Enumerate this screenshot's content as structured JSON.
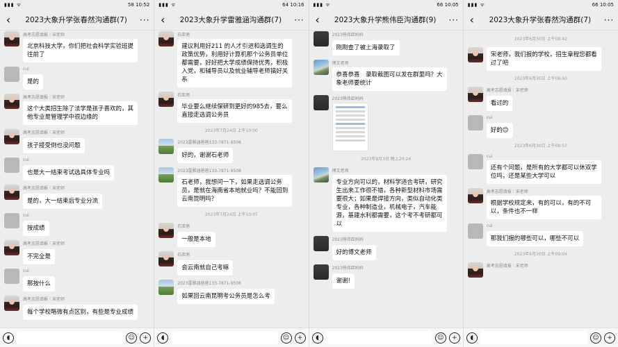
{
  "panels": [
    {
      "status": {
        "time": "10:52",
        "battery": "58"
      },
      "title": "2023大象升学张春然沟通群(7)",
      "messages": [
        {
          "type": "msg",
          "avatar": "person",
          "name": "高考志愿填报｜宋老师",
          "text": "北京科技大学，你们把社会科学实验班提往前了"
        },
        {
          "type": "msg",
          "avatar": "gray",
          "name": "cui",
          "text": "是的"
        },
        {
          "type": "msg",
          "avatar": "person",
          "name": "高考志愿填报｜宋老师",
          "text": "这个大类招生除了法学是孩子喜欢的，其他专业是管理学中很边缘的"
        },
        {
          "type": "msg",
          "avatar": "person",
          "name": "高考志愿填报｜宋老师",
          "text": "孩子接受倒也没问题"
        },
        {
          "type": "msg",
          "avatar": "gray",
          "name": "cui",
          "text": "也是大一结束考试选具体专业吗"
        },
        {
          "type": "msg",
          "avatar": "person",
          "name": "高考志愿填报｜宋老师",
          "text": "是的，大一结束后专业分流"
        },
        {
          "type": "msg",
          "avatar": "gray",
          "name": "cui",
          "text": "按成绩"
        },
        {
          "type": "msg",
          "avatar": "person",
          "name": "高考志愿填报｜宋老师",
          "text": "不完全是"
        },
        {
          "type": "msg",
          "avatar": "gray",
          "name": "cui",
          "text": "那按什么"
        },
        {
          "type": "msg",
          "avatar": "person",
          "name": "高考志愿填报｜宋老师",
          "text": "每个学校略微有点区别，有些是专业成绩"
        }
      ]
    },
    {
      "status": {
        "time": "10:16",
        "battery": "64"
      },
      "title": "2023大象升学雷雅涵沟通群(7)",
      "messages": [
        {
          "type": "msg",
          "avatar": "person",
          "name": "石亚男",
          "text": "建议利用好211 的人才引进和选调生的政策优势，利用好计算机那个公务员单位都需要，好好把大学成绩保持优秀，积极入党，和辅导员以及就业辅导老师搞好关系"
        },
        {
          "type": "msg",
          "avatar": "person",
          "name": "石亚男",
          "text": "毕业要么继续保研到更好的985去，要么直接走选调公务员"
        },
        {
          "type": "time",
          "text": "2023年7月24日 上午10:00"
        },
        {
          "type": "msg",
          "avatar": "landscape",
          "name": "2023雷雅涵爸爸133-7871-9508",
          "text": "好的，谢谢石老师"
        },
        {
          "type": "msg",
          "avatar": "landscape",
          "name": "2023雷雅涵爸爸133-7871-9508",
          "text": "石老师，我想问一下，如果走选调公务员，是就在海南省本地就业吗？不能回到云南昆明吗？"
        },
        {
          "type": "time",
          "text": "2023年7月24日 上午10:07"
        },
        {
          "type": "msg",
          "avatar": "person",
          "name": "石亚男",
          "text": "一般是本地"
        },
        {
          "type": "msg",
          "avatar": "person",
          "name": "石亚男",
          "text": "会云南就自己考嘛"
        },
        {
          "type": "msg",
          "avatar": "landscape",
          "name": "2023雷雅涵爸爸133-7871-9508",
          "text": "如果回云南昆明考公务员是怎么考"
        }
      ]
    },
    {
      "status": {
        "time": "10:05",
        "battery": "66"
      },
      "title": "2023大象升学熊伟臣沟通群(9)",
      "messages": [
        {
          "type": "msg",
          "avatar": "dark",
          "name": "2023熊伟臣妈妈",
          "text": "刚刚查了被上海录取了"
        },
        {
          "type": "msg",
          "avatar": "mountain",
          "name": "博文老师",
          "text": "恭喜恭喜　录取截图可以发在群里吗？大象老师要统计"
        },
        {
          "type": "image",
          "avatar": "dark",
          "name": "2023熊伟臣妈妈"
        },
        {
          "type": "time",
          "text": "2023年8月3日 晚上20:24"
        },
        {
          "type": "msg",
          "avatar": "mountain",
          "name": "博文老师",
          "text": "专业方向可以的，材料学适合考研，研究生出来工作很不错，各种新型材料市场需要很大；如果是焊接方向，类似自动化类专业，各种制造业，机械电子，汽车能源，基建水利都需要，这个考不考研都可以"
        },
        {
          "type": "msg",
          "avatar": "dark",
          "name": "2023熊伟臣妈妈",
          "text": "好的博文老师"
        },
        {
          "type": "msg",
          "avatar": "dark",
          "name": "2023熊伟臣妈妈",
          "text": "谢谢!"
        }
      ]
    },
    {
      "status": {
        "time": "10:05",
        "battery": "66"
      },
      "title": "2023大象升学张春然沟通群(7)",
      "messages": [
        {
          "type": "time",
          "text": "2023年6月30日 上午08:42"
        },
        {
          "type": "msg",
          "avatar": "person",
          "name": "",
          "text": "宋老师，我们报的学校，招生章程您都看过了吧"
        },
        {
          "type": "time",
          "text": "2023年6月30日 上午08:50"
        },
        {
          "type": "msg",
          "avatar": "person",
          "name": "高考志愿填报｜宋老师",
          "text": "看过的"
        },
        {
          "type": "msg",
          "avatar": "gray",
          "name": "cui",
          "text": "好的😊"
        },
        {
          "type": "time",
          "text": "2023年6月30日 上午08:57"
        },
        {
          "type": "msg",
          "avatar": "gray",
          "name": "cui",
          "text": "还有个问题，是所有的大学都可以休双学位吗，还是某些大学可以"
        },
        {
          "type": "msg",
          "avatar": "person",
          "name": "高考志愿填报｜宋老师",
          "text": "根据学校规定来，有的可以，有的不可以，条件也不一样"
        },
        {
          "type": "msg",
          "avatar": "gray",
          "name": "cui",
          "text": "那我们报的哪些可以，哪些不可以"
        },
        {
          "type": "time",
          "text": "2023年6月30日 上午09:04"
        },
        {
          "type": "msg",
          "avatar": "person",
          "name": "高考志愿填报｜宋老师",
          "text": ""
        }
      ]
    }
  ],
  "icons": {
    "back": "back-arrow-icon",
    "more": "more-dots-icon",
    "voice": "voice-icon",
    "emoji": "emoji-icon",
    "plus": "plus-icon"
  }
}
